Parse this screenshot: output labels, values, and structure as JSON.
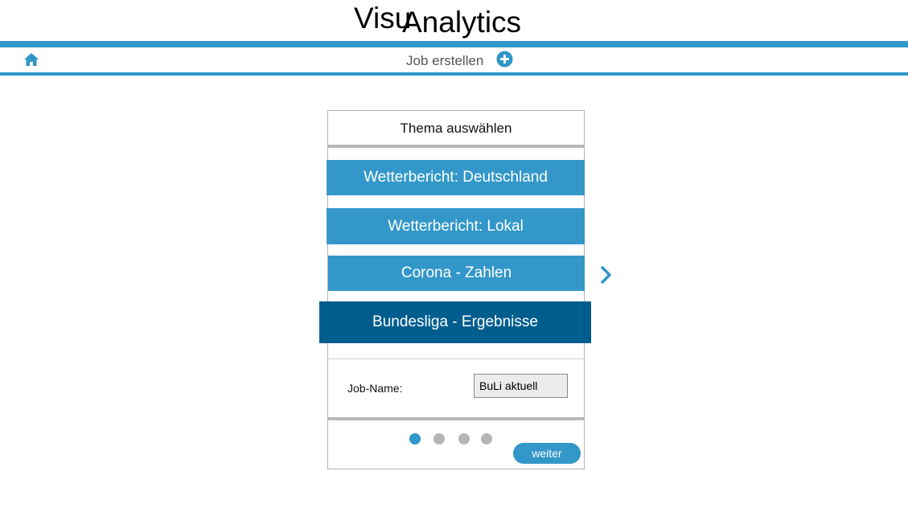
{
  "logo": {
    "part1": "Visu",
    "part2": "Analytics"
  },
  "nav": {
    "home_icon": "home-icon",
    "title": "Job erstellen",
    "add_icon": "plus-circle-icon"
  },
  "card": {
    "title": "Thema auswählen",
    "topics": [
      {
        "label": "Wetterbericht: Deutschland",
        "selected": false
      },
      {
        "label": "Wetterbericht: Lokal",
        "selected": false
      },
      {
        "label": "Corona - Zahlen",
        "selected": false
      },
      {
        "label": "Bundesliga - Ergebnisse",
        "selected": true
      }
    ],
    "next_arrow_icon": "chevron-right-icon",
    "job_name_label": "Job-Name:",
    "job_name_value": "BuLi aktuell",
    "pagination": {
      "total": 4,
      "active": 1
    },
    "next_button": "weiter"
  },
  "colors": {
    "accent": "#2f96c8",
    "topic": "#3398c9",
    "topic_selected": "#005e8e",
    "separator": "#b8b8b8",
    "dot_inactive": "#b5b5b5"
  }
}
